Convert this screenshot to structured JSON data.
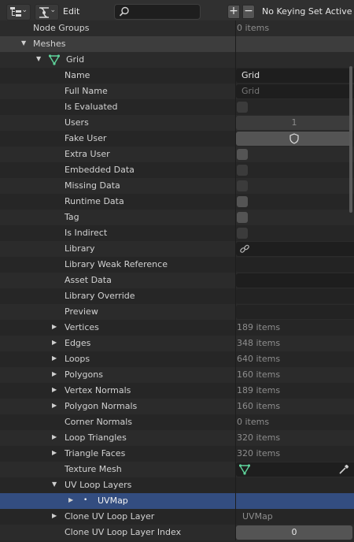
{
  "header": {
    "display_mode_icon": "outliner-display-mode-icon",
    "filter_icon": "node-tree-icon",
    "edit_label": "Edit",
    "search_placeholder": "",
    "add_label": "+",
    "remove_label": "−",
    "keying_set_label": "No Keying Set Active"
  },
  "rows": {
    "node_groups": {
      "label": "Node Groups",
      "value": "0 items"
    },
    "meshes": {
      "label": "Meshes"
    },
    "grid": {
      "label": "Grid",
      "icon": "mesh-data-icon"
    },
    "name": {
      "label": "Name",
      "value": "Grid"
    },
    "full_name": {
      "label": "Full Name",
      "value": "Grid"
    },
    "is_evaluated": {
      "label": "Is Evaluated"
    },
    "users": {
      "label": "Users",
      "value": "1"
    },
    "fake_user": {
      "label": "Fake User",
      "icon": "shield-icon"
    },
    "extra_user": {
      "label": "Extra User"
    },
    "embedded_data": {
      "label": "Embedded Data"
    },
    "missing_data": {
      "label": "Missing Data"
    },
    "runtime_data": {
      "label": "Runtime Data"
    },
    "tag": {
      "label": "Tag"
    },
    "is_indirect": {
      "label": "Is Indirect"
    },
    "library": {
      "label": "Library",
      "icon": "link-icon"
    },
    "library_weak_reference": {
      "label": "Library Weak Reference"
    },
    "asset_data": {
      "label": "Asset Data"
    },
    "library_override": {
      "label": "Library Override"
    },
    "preview": {
      "label": "Preview"
    },
    "vertices": {
      "label": "Vertices",
      "value": "189 items"
    },
    "edges": {
      "label": "Edges",
      "value": "348 items"
    },
    "loops": {
      "label": "Loops",
      "value": "640 items"
    },
    "polygons": {
      "label": "Polygons",
      "value": "160 items"
    },
    "vertex_normals": {
      "label": "Vertex Normals",
      "value": "189 items"
    },
    "polygon_normals": {
      "label": "Polygon Normals",
      "value": "160 items"
    },
    "corner_normals": {
      "label": "Corner Normals",
      "value": "0 items"
    },
    "loop_triangles": {
      "label": "Loop Triangles",
      "value": "320 items"
    },
    "triangle_faces": {
      "label": "Triangle Faces",
      "value": "320 items"
    },
    "texture_mesh": {
      "label": "Texture Mesh",
      "icon": "mesh-data-icon",
      "picker_icon": "eyedropper-icon"
    },
    "uv_loop_layers": {
      "label": "UV Loop Layers"
    },
    "uvmap": {
      "label": "UVMap"
    },
    "clone_uv_loop_layer": {
      "label": "Clone UV Loop Layer",
      "value": "UVMap"
    },
    "clone_uv_loop_layer_index": {
      "label": "Clone UV Loop Layer Index",
      "value": "0"
    }
  },
  "colors": {
    "background": "#282828",
    "header": "#303030",
    "selection": "#334d80",
    "mesh_icon": "#5fd39b"
  }
}
